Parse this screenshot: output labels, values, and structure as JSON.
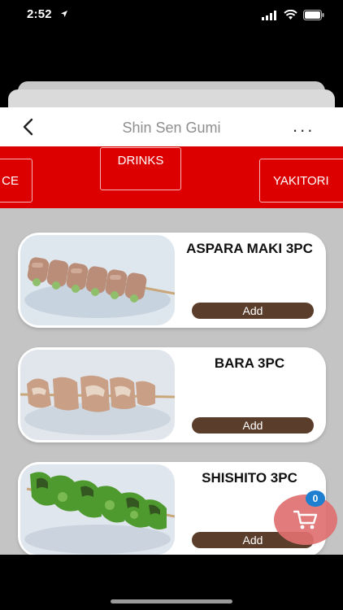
{
  "status": {
    "time": "2:52",
    "icons": [
      "location-arrow-icon",
      "signal-icon",
      "wifi-icon",
      "battery-icon"
    ]
  },
  "nav": {
    "back_icon": "chevron-left-icon",
    "title": "Shin Sen Gumi",
    "more_label": "..."
  },
  "categories": [
    {
      "label": "CE"
    },
    {
      "label": "DRINKS"
    },
    {
      "label": "YAKITORI"
    }
  ],
  "items": [
    {
      "name": "ASPARA MAKI 3PC",
      "add_label": "Add",
      "image": "aspara-maki-skewer"
    },
    {
      "name": "BARA 3PC",
      "add_label": "Add",
      "image": "bara-skewer"
    },
    {
      "name": "SHISHITO 3PC",
      "add_label": "Add",
      "image": "shishito-skewer"
    }
  ],
  "cart": {
    "icon": "cart-icon",
    "count": "0"
  },
  "colors": {
    "category_bar": "#dd0000",
    "add_button": "#5a3d2b",
    "cart_fab": "#e07070",
    "badge": "#1e7fd0",
    "sheet_background": "#c4c4c4"
  }
}
